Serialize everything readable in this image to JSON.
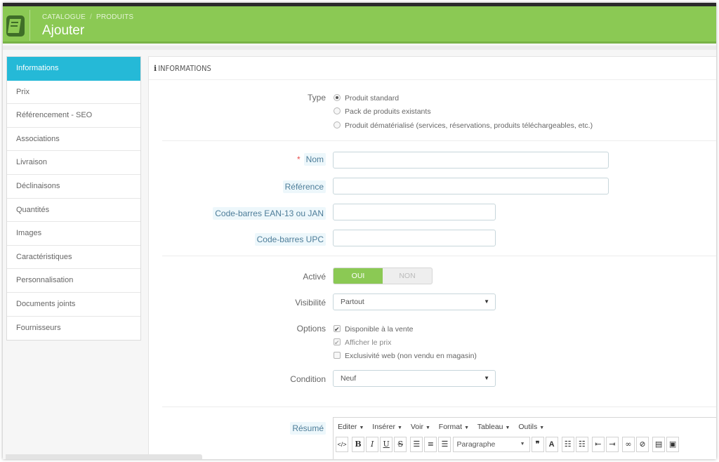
{
  "header": {
    "breadcrumb": [
      "CATALOGUE",
      "PRODUITS"
    ],
    "title": "Ajouter",
    "colors": {
      "header": "#8bc954",
      "active_tab": "#25b9d7"
    }
  },
  "sidebar": {
    "items": [
      {
        "label": "Informations",
        "active": true
      },
      {
        "label": "Prix"
      },
      {
        "label": "Référencement - SEO"
      },
      {
        "label": "Associations"
      },
      {
        "label": "Livraison"
      },
      {
        "label": "Déclinaisons"
      },
      {
        "label": "Quantités"
      },
      {
        "label": "Images"
      },
      {
        "label": "Caractéristiques"
      },
      {
        "label": "Personnalisation"
      },
      {
        "label": "Documents joints"
      },
      {
        "label": "Fournisseurs"
      }
    ]
  },
  "panel": {
    "heading_icon": "i",
    "heading": "INFORMATIONS"
  },
  "form": {
    "type_label": "Type",
    "type_options": [
      {
        "label": "Produit standard",
        "checked": true
      },
      {
        "label": "Pack de produits existants",
        "checked": false
      },
      {
        "label": "Produit dématérialisé (services, réservations, produits téléchargeables, etc.)",
        "checked": false
      }
    ],
    "required_mark": "*",
    "name_label": "Nom",
    "name_value": "",
    "reference_label": "Référence",
    "reference_value": "",
    "ean_label": "Code-barres EAN-13 ou JAN",
    "ean_value": "",
    "upc_label": "Code-barres UPC",
    "upc_value": "",
    "active_label": "Activé",
    "active_on": "OUI",
    "active_off": "NON",
    "visibility_label": "Visibilité",
    "visibility_value": "Partout",
    "options_label": "Options",
    "options": [
      {
        "label": "Disponible à la vente",
        "checked": true
      },
      {
        "label": "Afficher le prix",
        "checked": true,
        "disabled": true
      },
      {
        "label": "Exclusivité web (non vendu en magasin)",
        "checked": false
      }
    ],
    "condition_label": "Condition",
    "condition_value": "Neuf",
    "summary_label": "Résumé"
  },
  "editor": {
    "menu": [
      "Editer",
      "Insérer",
      "Voir",
      "Format",
      "Tableau",
      "Outils"
    ],
    "format_select": "Paragraphe",
    "tool_icons": [
      "code-icon",
      "bold-icon",
      "italic-icon",
      "underline-icon",
      "strikethrough-icon",
      "align-left-icon",
      "align-center-icon",
      "align-right-icon",
      "format-select",
      "blockquote-icon",
      "text-color-icon",
      "bullet-list-icon",
      "numbered-list-icon",
      "outdent-icon",
      "indent-icon",
      "link-icon",
      "unlink-icon",
      "media-icon",
      "image-icon"
    ]
  }
}
